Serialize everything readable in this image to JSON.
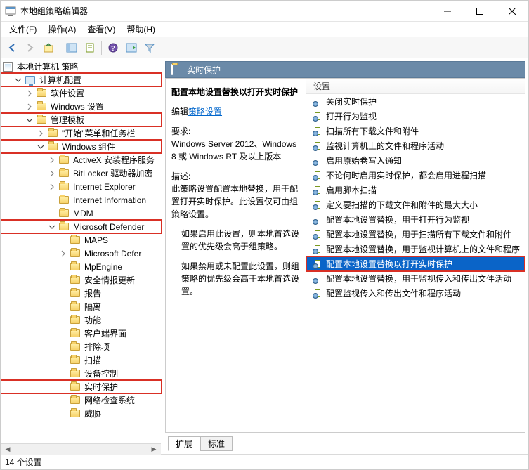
{
  "window": {
    "title": "本地组策略编辑器"
  },
  "menubar": [
    {
      "label": "文件(F)"
    },
    {
      "label": "操作(A)"
    },
    {
      "label": "查看(V)"
    },
    {
      "label": "帮助(H)"
    }
  ],
  "tree": {
    "root": "本地计算机 策略",
    "nodes": [
      {
        "d": 1,
        "exp": "open",
        "label": "计算机配置",
        "hl": true,
        "icon": "comp"
      },
      {
        "d": 2,
        "exp": "closed",
        "label": "软件设置",
        "icon": "folder"
      },
      {
        "d": 2,
        "exp": "closed",
        "label": "Windows 设置",
        "icon": "folder"
      },
      {
        "d": 2,
        "exp": "open",
        "label": "管理模板",
        "hl": true,
        "icon": "folder"
      },
      {
        "d": 3,
        "exp": "closed",
        "label": "\"开始\"菜单和任务栏",
        "icon": "folder"
      },
      {
        "d": 3,
        "exp": "open",
        "label": "Windows 组件",
        "hl": true,
        "icon": "folder"
      },
      {
        "d": 4,
        "exp": "closed",
        "label": "ActiveX 安装程序服务",
        "icon": "folder"
      },
      {
        "d": 4,
        "exp": "closed",
        "label": "BitLocker 驱动器加密",
        "icon": "folder"
      },
      {
        "d": 4,
        "exp": "closed",
        "label": "Internet Explorer",
        "icon": "folder"
      },
      {
        "d": 4,
        "exp": "none",
        "label": "Internet Information",
        "icon": "folder"
      },
      {
        "d": 4,
        "exp": "none",
        "label": "MDM",
        "icon": "folder"
      },
      {
        "d": 4,
        "exp": "open",
        "label": "Microsoft Defender",
        "hl": true,
        "icon": "folder"
      },
      {
        "d": 5,
        "exp": "none",
        "label": "MAPS",
        "icon": "folder"
      },
      {
        "d": 5,
        "exp": "closed",
        "label": "Microsoft Defer",
        "icon": "folder"
      },
      {
        "d": 5,
        "exp": "none",
        "label": "MpEngine",
        "icon": "folder"
      },
      {
        "d": 5,
        "exp": "none",
        "label": "安全情报更新",
        "icon": "folder"
      },
      {
        "d": 5,
        "exp": "none",
        "label": "报告",
        "icon": "folder"
      },
      {
        "d": 5,
        "exp": "none",
        "label": "隔离",
        "icon": "folder"
      },
      {
        "d": 5,
        "exp": "none",
        "label": "功能",
        "icon": "folder"
      },
      {
        "d": 5,
        "exp": "none",
        "label": "客户端界面",
        "icon": "folder"
      },
      {
        "d": 5,
        "exp": "none",
        "label": "排除项",
        "icon": "folder"
      },
      {
        "d": 5,
        "exp": "none",
        "label": "扫描",
        "icon": "folder"
      },
      {
        "d": 5,
        "exp": "none",
        "label": "设备控制",
        "icon": "folder"
      },
      {
        "d": 5,
        "exp": "none",
        "label": "实时保护",
        "hl": true,
        "icon": "folder"
      },
      {
        "d": 5,
        "exp": "none",
        "label": "网络检查系统",
        "icon": "folder"
      },
      {
        "d": 5,
        "exp": "none",
        "label": "威胁",
        "icon": "folder"
      }
    ]
  },
  "content": {
    "header": "实时保护",
    "desc_title": "配置本地设置替换以打开实时保护",
    "edit_link_prefix": "编辑",
    "edit_link": "策略设置",
    "req_label": "要求:",
    "req_text": "Windows Server 2012、Windows 8 或 Windows RT 及以上版本",
    "desc_label": "描述:",
    "desc_p1": "此策略设置配置本地替换，用于配置打开实时保护。此设置仅可由组策略设置。",
    "desc_p2": "如果启用此设置，则本地首选设置的优先级会高于组策略。",
    "desc_p3": "如果禁用或未配置此设置，则组策略的优先级会高于本地首选设置。",
    "list_header": "设置",
    "policies": [
      {
        "label": "关闭实时保护"
      },
      {
        "label": "打开行为监视"
      },
      {
        "label": "扫描所有下载文件和附件"
      },
      {
        "label": "监视计算机上的文件和程序活动"
      },
      {
        "label": "启用原始卷写入通知"
      },
      {
        "label": "不论何时启用实时保护，都会启用进程扫描"
      },
      {
        "label": "启用脚本扫描"
      },
      {
        "label": "定义要扫描的下载文件和附件的最大大小"
      },
      {
        "label": "配置本地设置替换，用于打开行为监视"
      },
      {
        "label": "配置本地设置替换，用于扫描所有下载文件和附件"
      },
      {
        "label": "配置本地设置替换，用于监视计算机上的文件和程序"
      },
      {
        "label": "配置本地设置替换以打开实时保护",
        "sel": true,
        "hl": true
      },
      {
        "label": "配置本地设置替换，用于监视传入和传出文件活动"
      },
      {
        "label": "配置监视传入和传出文件和程序活动"
      }
    ],
    "tabs": [
      {
        "label": "扩展",
        "active": true
      },
      {
        "label": "标准",
        "active": false
      }
    ]
  },
  "status": "14 个设置"
}
